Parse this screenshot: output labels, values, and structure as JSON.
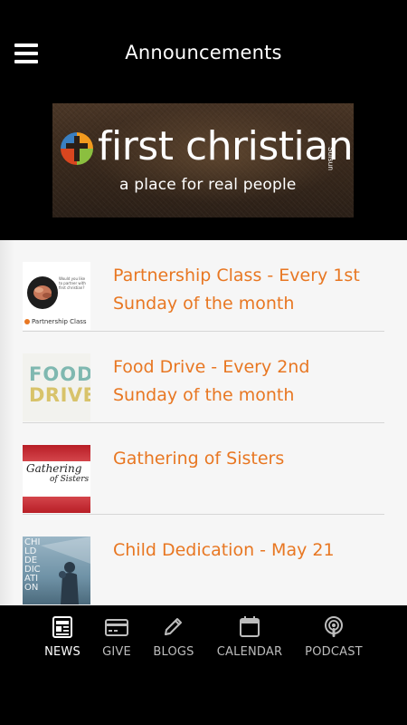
{
  "header": {
    "title": "Announcements"
  },
  "banner": {
    "brand": "first christian",
    "tagline": "a place for real people",
    "location": "Suisun"
  },
  "announcements": [
    {
      "title": "Partnership Class - Every 1st Sunday of the month",
      "thumb_caption": "Partnership Class",
      "thumb_quote": "Would you like to partner with first christian?"
    },
    {
      "title": "Food Drive - Every 2nd Sunday of the month",
      "thumb_word1": "FOOD",
      "thumb_word2": "DRIVE"
    },
    {
      "title": "Gathering of Sisters",
      "thumb_heading": "Gathering",
      "thumb_sub": "of Sisters"
    },
    {
      "title": "Child Dedication - May 21",
      "thumb_text": "CHILD DEDICATION"
    }
  ],
  "bottom_nav": {
    "items": [
      {
        "label": "NEWS",
        "icon": "news-icon",
        "active": true
      },
      {
        "label": "GIVE",
        "icon": "credit-card-icon",
        "active": false
      },
      {
        "label": "BLOGS",
        "icon": "pencil-icon",
        "active": false
      },
      {
        "label": "CALENDAR",
        "icon": "calendar-icon",
        "active": false
      },
      {
        "label": "PODCAST",
        "icon": "podcast-icon",
        "active": false
      }
    ]
  },
  "colors": {
    "accent": "#e87722",
    "header_bg": "#000000",
    "list_bg": "#f6f6f6",
    "nav_active": "#ffffff",
    "nav_inactive": "#bdbdbd"
  }
}
